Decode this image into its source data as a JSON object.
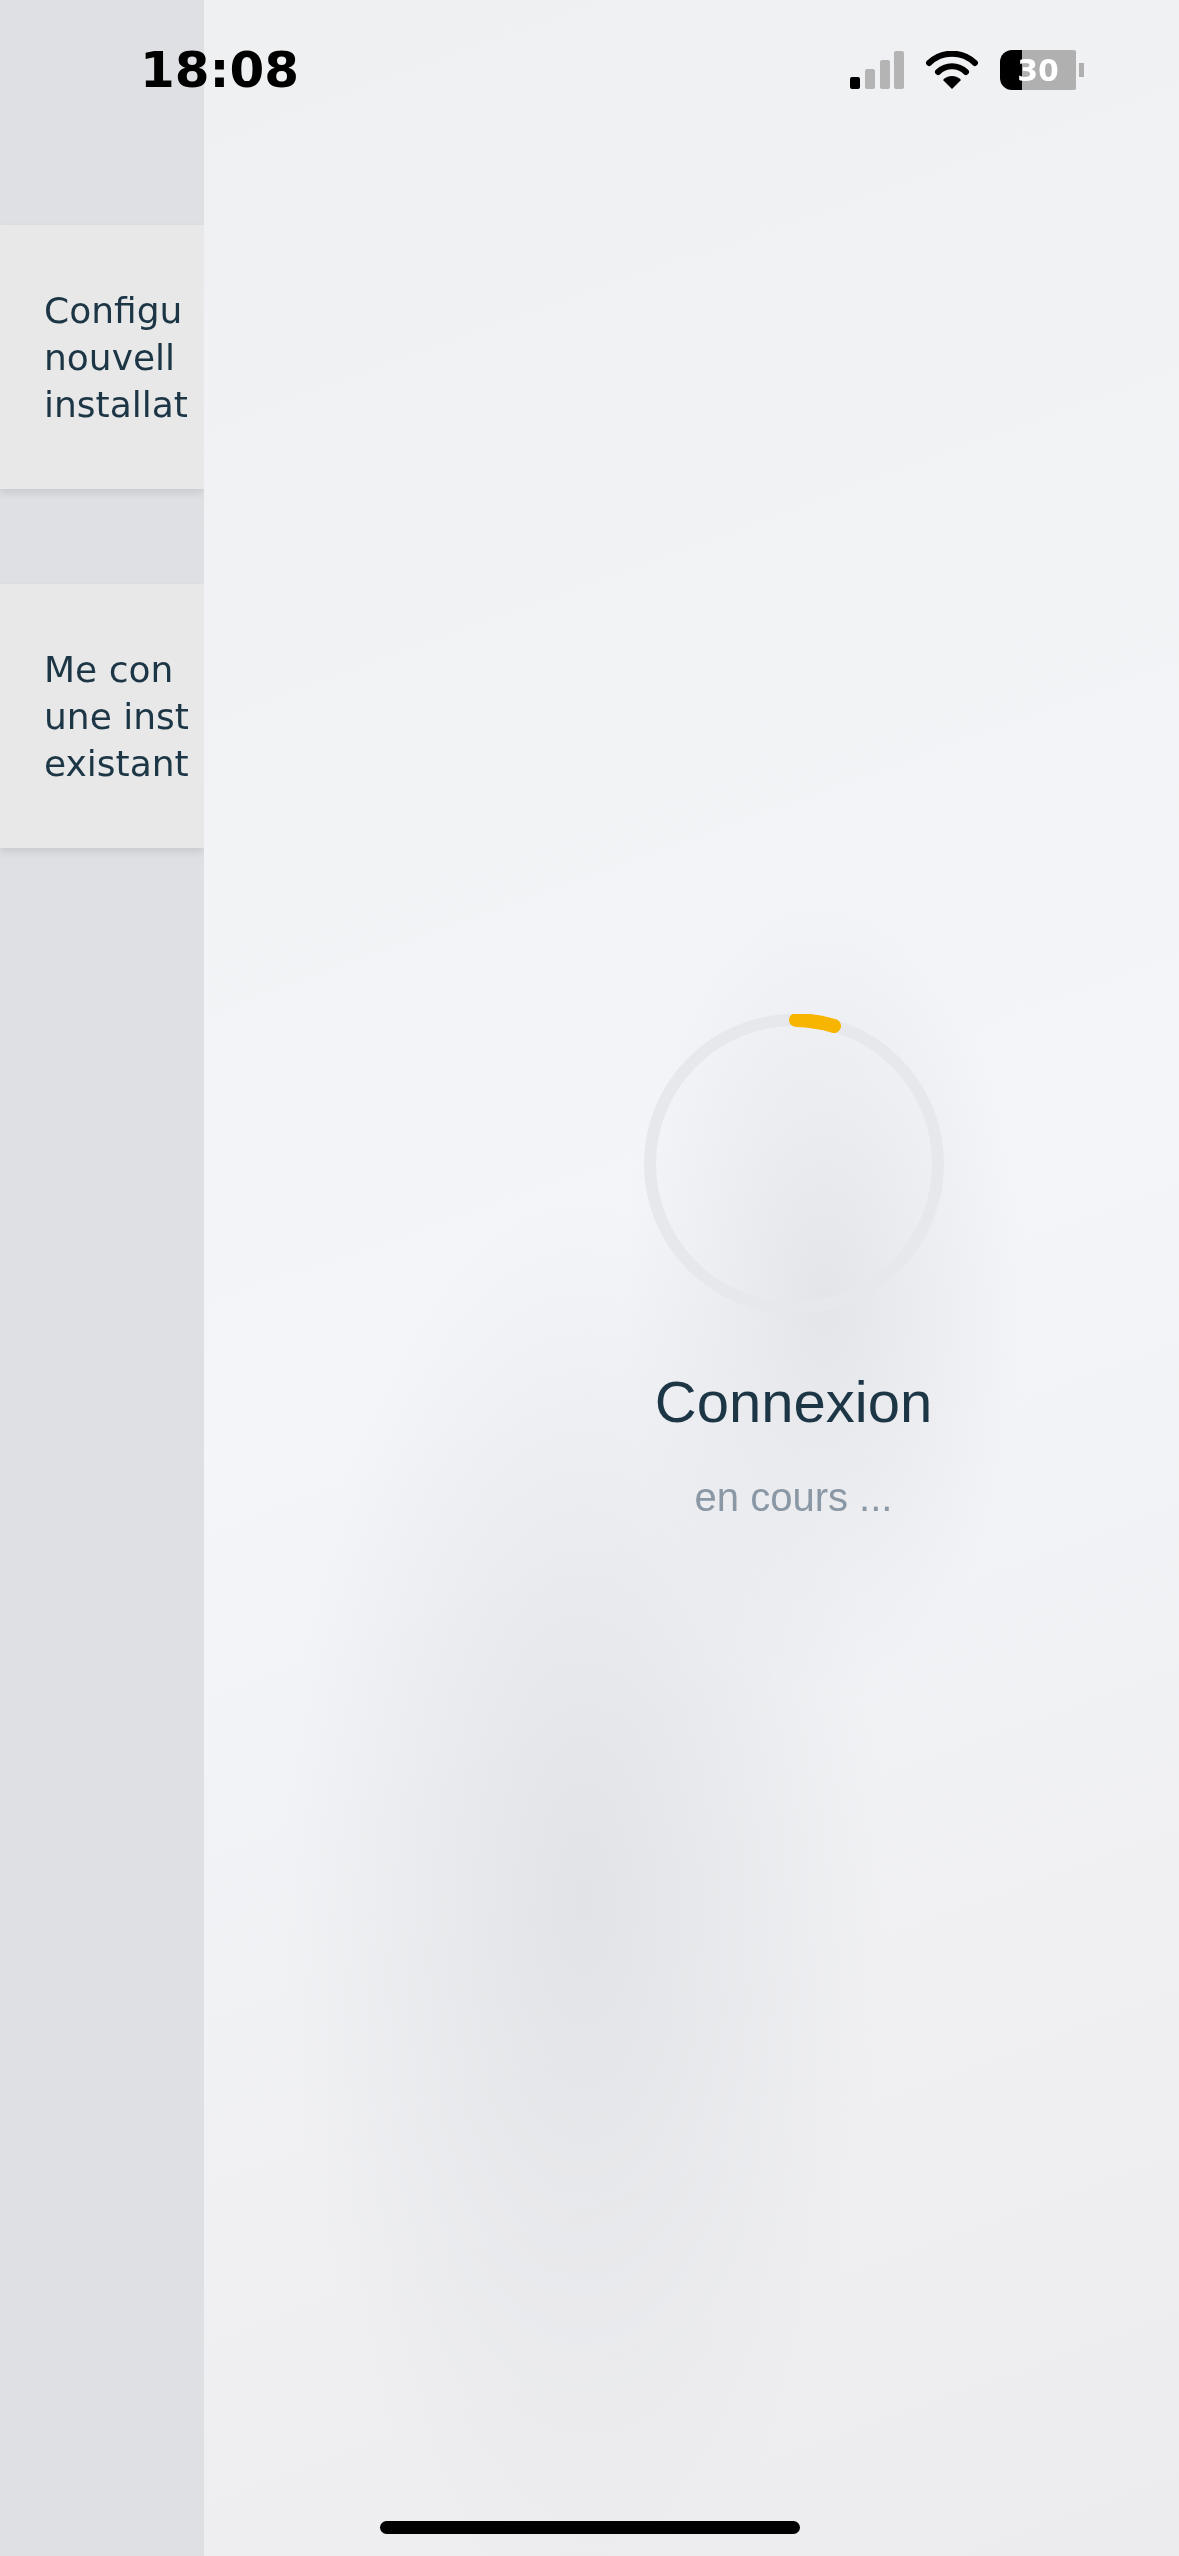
{
  "status_bar": {
    "time": "18:08",
    "battery": "30"
  },
  "menu_cards": [
    {
      "lines": [
        "Configu",
        "nouvell",
        "installat"
      ]
    },
    {
      "lines": [
        "Me con",
        "une inst",
        "existant"
      ]
    }
  ],
  "loading": {
    "title": "Connexion",
    "subtitle": "en cours ..."
  }
}
